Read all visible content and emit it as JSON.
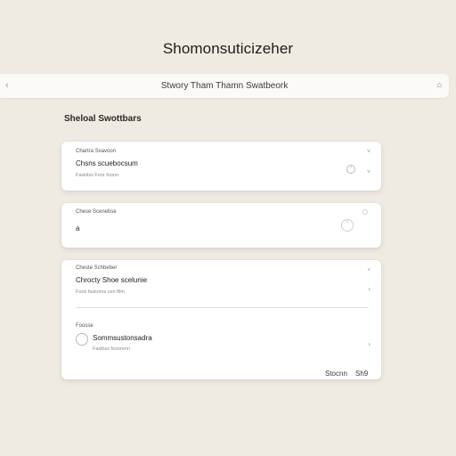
{
  "app": {
    "title": "Shomonsuticizeher"
  },
  "toolbar": {
    "back_glyph": "‹",
    "breadcrumb": "Stwory Tham Thamn Swatbeork",
    "home_glyph": "⌂"
  },
  "section": {
    "title": "Sheloal Swottbars"
  },
  "card1": {
    "label": "Chartra Sxavoon",
    "value": "Chsns scuebocsum",
    "hint": "Faskilss Fonr foonn",
    "chevron_up": "˅",
    "chevron_down": "˅"
  },
  "card2": {
    "label": "Chese Scenebse",
    "value": "a"
  },
  "card3": {
    "label": "Cheste Schbeber",
    "value": "Chrocty Shoe scelunie",
    "hint": "Fonk faskoms osn ftlm",
    "chevron_right": "›",
    "option_label": "Foosse",
    "option_value": "Sommsustonsadra",
    "option_hint": "Faxibss fosorenn",
    "cancel_label": "Stocnn",
    "ok_label": "Sh9"
  }
}
